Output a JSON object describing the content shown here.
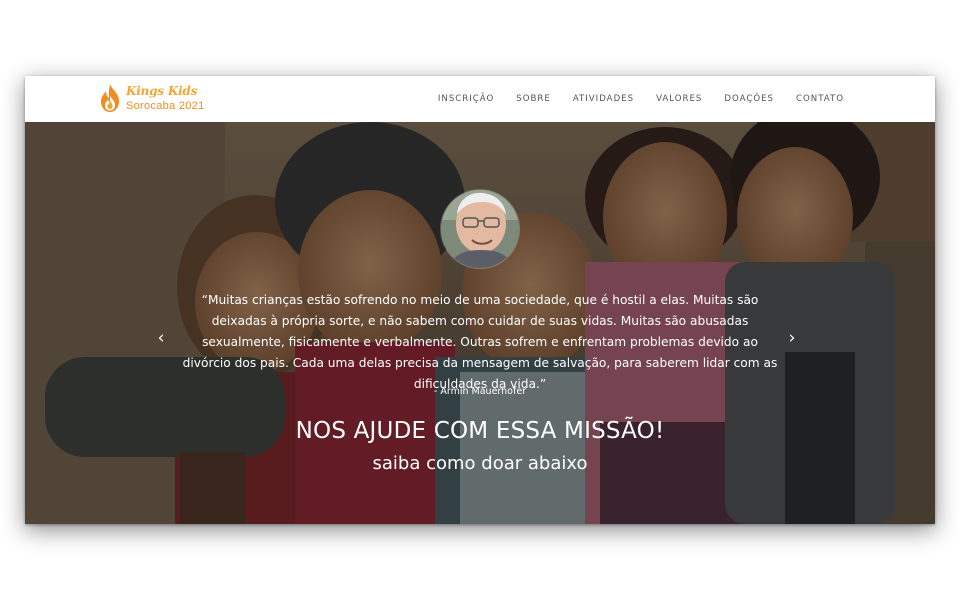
{
  "brand": {
    "line1": "Kings Kids",
    "line2": "Sorocaba 2021",
    "flame_color": "#f08d1f"
  },
  "nav": {
    "items": [
      "INSCRIÇÃO",
      "SOBRE",
      "ATIVIDADES",
      "VALORES",
      "DOAÇÕES",
      "CONTATO"
    ]
  },
  "hero": {
    "quote": "“Muitas crianças estão sofrendo no meio de uma sociedade, que é hostil a elas. Muitas são deixadas à própria sorte, e não sabem como cuidar de suas vidas. Muitas são abusadas sexualmente, fisicamente e verbalmente. Outras sofrem e enfrentam problemas devido ao divórcio dos pais. Cada uma delas precisa da mensagem de salvação, para saberem lidar com as dificuldades da vida.”",
    "author": "- Armin Mauerhofer",
    "headline": "NOS AJUDE COM ESSA MISSÃO!",
    "subheadline": "saiba como doar abaixo",
    "prev_icon": "chevron-left-icon",
    "next_icon": "chevron-right-icon"
  }
}
